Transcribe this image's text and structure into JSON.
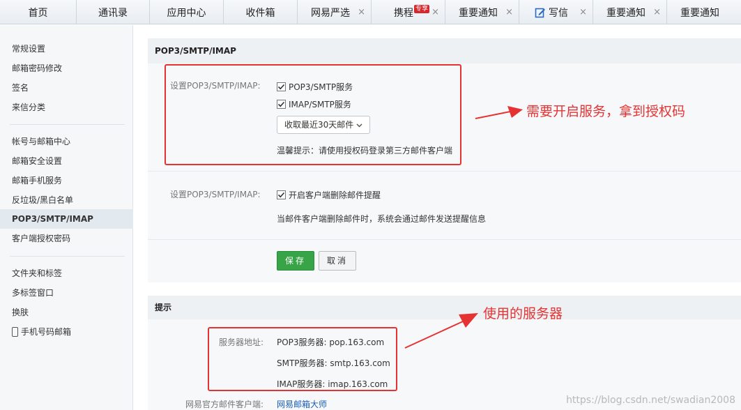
{
  "tabs": [
    {
      "label": "首页",
      "closable": false
    },
    {
      "label": "通讯录",
      "closable": false
    },
    {
      "label": "应用中心",
      "closable": false
    },
    {
      "label": "收件箱",
      "closable": false
    },
    {
      "label": "网易严选",
      "closable": true
    },
    {
      "label": "携程",
      "badge": "专享",
      "closable": true
    },
    {
      "label": "重要通知",
      "closable": true
    },
    {
      "label": "写信",
      "closable": true,
      "icon": "edit-icon"
    },
    {
      "label": "重要通知",
      "closable": true
    },
    {
      "label": "重要通知",
      "closable": true
    }
  ],
  "close_glyph": "×",
  "sidebar": {
    "groups": [
      [
        "常规设置",
        "邮箱密码修改",
        "签名",
        "来信分类"
      ],
      [
        "帐号与邮箱中心",
        "邮箱安全设置",
        "邮箱手机服务",
        "反垃圾/黑白名单",
        "POP3/SMTP/IMAP",
        "客户端授权密码"
      ],
      [
        "文件夹和标签",
        "多标签窗口",
        "换肤",
        "手机号码邮箱"
      ]
    ],
    "active": "POP3/SMTP/IMAP"
  },
  "pop3_section": {
    "title": "POP3/SMTP/IMAP",
    "row1": {
      "label": "设置POP3/SMTP/IMAP:",
      "opt1": "POP3/SMTP服务",
      "opt1_checked": true,
      "opt2": "IMAP/SMTP服务",
      "opt2_checked": true,
      "select_value": "收取最近30天邮件",
      "tip": "温馨提示：请使用授权码登录第三方邮件客户端"
    },
    "row2": {
      "label": "设置POP3/SMTP/IMAP:",
      "opt": "开启客户端删除邮件提醒",
      "opt_checked": true,
      "desc": "当邮件客户端删除邮件时，系统会通过邮件发送提醒信息"
    },
    "save": "保存",
    "cancel": "取消"
  },
  "tips_section": {
    "title": "提示",
    "server_label": "服务器地址:",
    "servers": [
      "POP3服务器: pop.163.com",
      "SMTP服务器: smtp.163.com",
      "IMAP服务器: imap.163.com"
    ],
    "client_label": "网易官方邮件客户端:",
    "client_link": "网易邮箱大师"
  },
  "annotations": {
    "note1": "需要开启服务，拿到授权码",
    "note2": "使用的服务器",
    "color": "#e53333"
  },
  "watermark": "https://blog.csdn.net/swadian2008"
}
